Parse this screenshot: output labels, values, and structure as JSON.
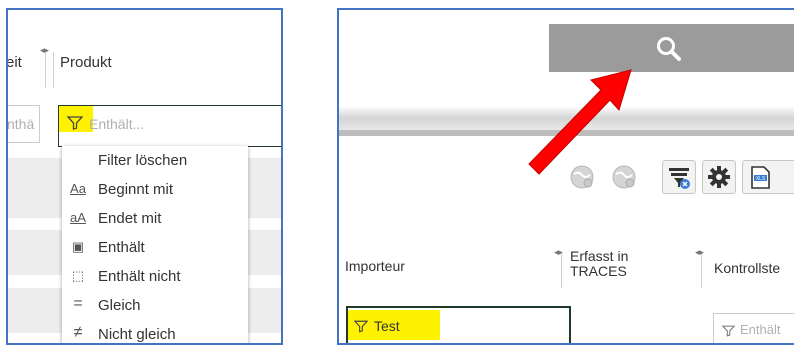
{
  "left": {
    "col_prev_label": "eit",
    "col_product_label": "Produkt",
    "prev_filter_value": "nthä",
    "product_filter_placeholder": "Enthält...",
    "filter_menu": [
      {
        "icon": "",
        "label": "Filter löschen"
      },
      {
        "icon": "Aa",
        "label": "Beginnt mit"
      },
      {
        "icon": "aA",
        "label": "Endet mit"
      },
      {
        "icon": "▣",
        "label": "Enthält"
      },
      {
        "icon": "⬚",
        "label": "Enthält nicht"
      },
      {
        "icon": "=",
        "label": "Gleich"
      },
      {
        "icon": "≠",
        "label": "Nicht gleich"
      }
    ]
  },
  "right": {
    "col_importer_label": "Importeur",
    "col_captured_line1": "Erfasst in",
    "col_captured_line2": "TRACES",
    "col_control_label": "Kontrollste",
    "importer_filter_value": "Test",
    "control_filter_placeholder": "Enthält"
  },
  "colors": {
    "frame": "#4472c4",
    "highlight": "#fff200",
    "arrow": "#ff0000",
    "search_bar": "#9b9b9b"
  },
  "icons": [
    "filter-icon",
    "search-icon",
    "globe-icon",
    "filter-clear-icon",
    "gear-icon",
    "excel-export-icon",
    "column-resize-icon"
  ]
}
